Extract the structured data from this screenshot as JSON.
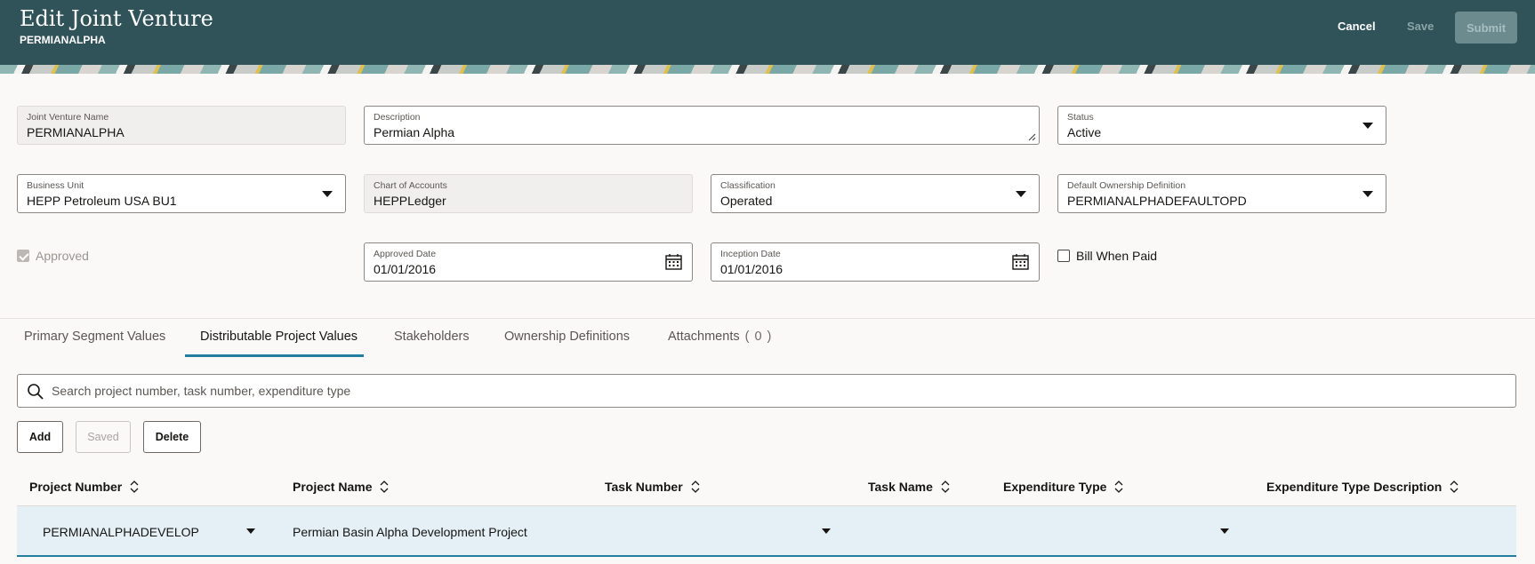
{
  "header": {
    "title": "Edit Joint Venture",
    "subtitle": "PERMIANALPHA",
    "cancel_label": "Cancel",
    "save_label": "Save",
    "submit_label": "Submit"
  },
  "form": {
    "jv_name": {
      "label": "Joint Venture Name",
      "value": "PERMIANALPHA"
    },
    "description": {
      "label": "Description",
      "value": "Permian Alpha"
    },
    "status": {
      "label": "Status",
      "value": "Active"
    },
    "business_unit": {
      "label": "Business Unit",
      "value": "HEPP Petroleum USA BU1"
    },
    "chart_of_accounts": {
      "label": "Chart of Accounts",
      "value": "HEPPLedger"
    },
    "classification": {
      "label": "Classification",
      "value": "Operated"
    },
    "default_ownership": {
      "label": "Default Ownership Definition",
      "value": "PERMIANALPHADEFAULTOPD"
    },
    "approved": {
      "label": "Approved",
      "checked": true,
      "disabled": true
    },
    "approved_date": {
      "label": "Approved Date",
      "value": "01/01/2016"
    },
    "inception_date": {
      "label": "Inception Date",
      "value": "01/01/2016"
    },
    "bill_when_paid": {
      "label": "Bill When Paid",
      "checked": false
    }
  },
  "tabs": [
    {
      "label": "Primary Segment Values"
    },
    {
      "label": "Distributable Project Values",
      "active": true
    },
    {
      "label": "Stakeholders"
    },
    {
      "label": "Ownership Definitions"
    },
    {
      "label": "Attachments",
      "count": "( 0 )"
    }
  ],
  "search": {
    "placeholder": "Search project number, task number, expenditure type"
  },
  "toolbar": {
    "add_label": "Add",
    "saved_label": "Saved",
    "delete_label": "Delete"
  },
  "table": {
    "columns": [
      "Project Number",
      "Project Name",
      "Task Number",
      "Task Name",
      "Expenditure Type",
      "Expenditure Type Description"
    ],
    "rows": [
      {
        "project_number": "PERMIANALPHADEVELOP",
        "project_name": "Permian Basin Alpha Development Project",
        "task_number": "",
        "task_name": "",
        "expenditure_type": "",
        "expenditure_type_description": ""
      }
    ]
  },
  "colors": {
    "header_bg": "#30535a",
    "accent": "#227e9e",
    "selected_row": "#e4f0f5"
  }
}
